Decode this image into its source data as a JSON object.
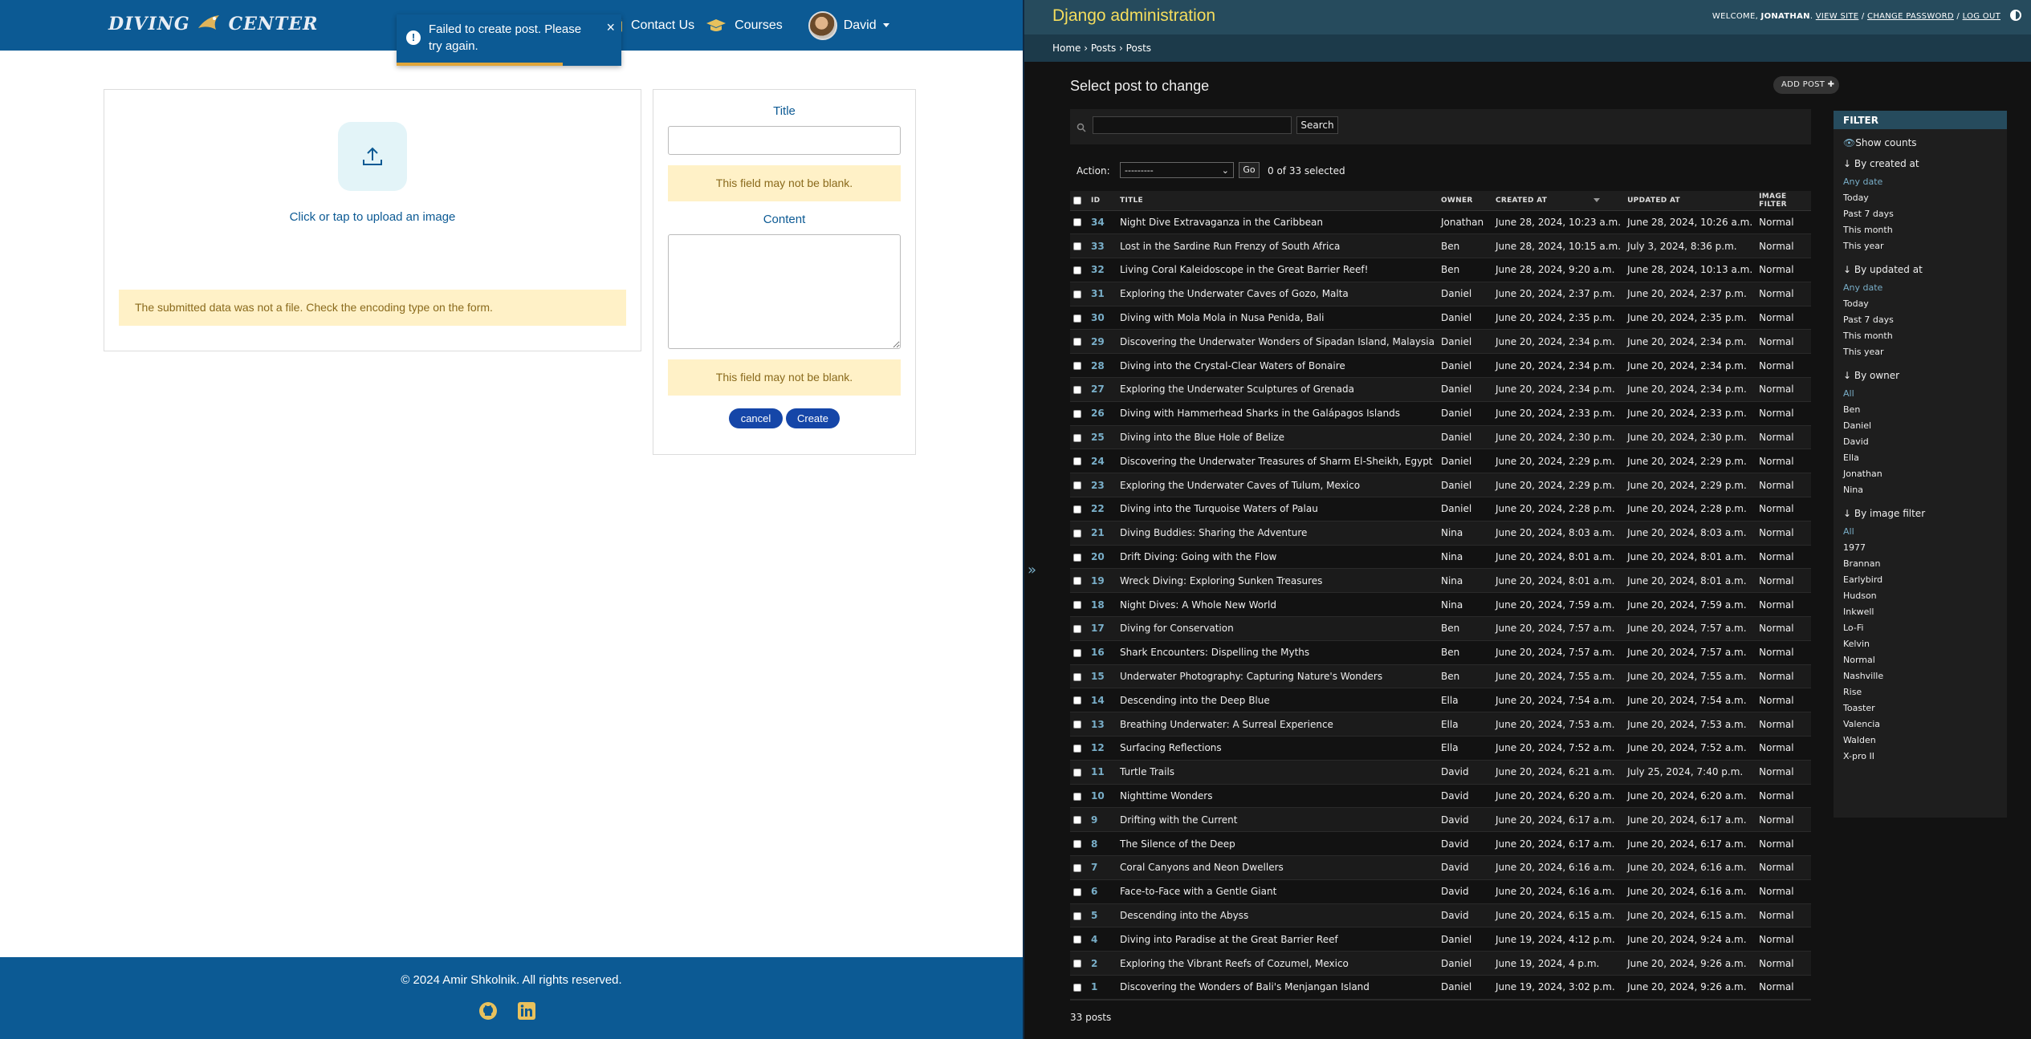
{
  "app": {
    "brand": "DIVING CENTER",
    "nav": {
      "contact": "Contact Us",
      "courses": "Courses",
      "user": "David"
    },
    "toast": {
      "message": "Failed to create post. Please try again.",
      "close": "×"
    },
    "upload": {
      "label": "Click or tap to upload an image",
      "error": "The submitted data was not a file. Check the encoding type on the form."
    },
    "form": {
      "title_label": "Title",
      "title_error": "This field may not be blank.",
      "content_label": "Content",
      "content_error": "This field may not be blank.",
      "cancel": "cancel",
      "create": "Create"
    },
    "footer": {
      "copyright": "© 2024 Amir Shkolnik. All rights reserved."
    }
  },
  "admin": {
    "brand": "Django administration",
    "welcome": "WELCOME,",
    "username": "JONATHAN",
    "view_site": "VIEW SITE",
    "change_password": "CHANGE PASSWORD",
    "logout": "LOG OUT",
    "breadcrumbs": {
      "home": "Home",
      "app": "Posts",
      "model": "Posts"
    },
    "sidebar_toggle": "»",
    "title": "Select post to change",
    "add_button": "ADD POST",
    "search_button": "Search",
    "action_label": "Action:",
    "action_selected": "---------",
    "go": "Go",
    "selected_count": "0 of 33 selected",
    "columns": [
      "ID",
      "TITLE",
      "OWNER",
      "CREATED AT",
      "UPDATED AT",
      "IMAGE FILTER"
    ],
    "rows": [
      [
        "34",
        "Night Dive Extravaganza in the Caribbean",
        "Jonathan",
        "June 28, 2024, 10:23 a.m.",
        "June 28, 2024, 10:26 a.m.",
        "Normal"
      ],
      [
        "33",
        "Lost in the Sardine Run Frenzy of South Africa",
        "Ben",
        "June 28, 2024, 10:15 a.m.",
        "July 3, 2024, 8:36 p.m.",
        "Normal"
      ],
      [
        "32",
        "Living Coral Kaleidoscope in the Great Barrier Reef!",
        "Ben",
        "June 28, 2024, 9:20 a.m.",
        "June 28, 2024, 10:13 a.m.",
        "Normal"
      ],
      [
        "31",
        "Exploring the Underwater Caves of Gozo, Malta",
        "Daniel",
        "June 20, 2024, 2:37 p.m.",
        "June 20, 2024, 2:37 p.m.",
        "Normal"
      ],
      [
        "30",
        "Diving with Mola Mola in Nusa Penida, Bali",
        "Daniel",
        "June 20, 2024, 2:35 p.m.",
        "June 20, 2024, 2:35 p.m.",
        "Normal"
      ],
      [
        "29",
        "Discovering the Underwater Wonders of Sipadan Island, Malaysia",
        "Daniel",
        "June 20, 2024, 2:34 p.m.",
        "June 20, 2024, 2:34 p.m.",
        "Normal"
      ],
      [
        "28",
        "Diving into the Crystal-Clear Waters of Bonaire",
        "Daniel",
        "June 20, 2024, 2:34 p.m.",
        "June 20, 2024, 2:34 p.m.",
        "Normal"
      ],
      [
        "27",
        "Exploring the Underwater Sculptures of Grenada",
        "Daniel",
        "June 20, 2024, 2:34 p.m.",
        "June 20, 2024, 2:34 p.m.",
        "Normal"
      ],
      [
        "26",
        "Diving with Hammerhead Sharks in the Galápagos Islands",
        "Daniel",
        "June 20, 2024, 2:33 p.m.",
        "June 20, 2024, 2:33 p.m.",
        "Normal"
      ],
      [
        "25",
        "Diving into the Blue Hole of Belize",
        "Daniel",
        "June 20, 2024, 2:30 p.m.",
        "June 20, 2024, 2:30 p.m.",
        "Normal"
      ],
      [
        "24",
        "Discovering the Underwater Treasures of Sharm El-Sheikh, Egypt",
        "Daniel",
        "June 20, 2024, 2:29 p.m.",
        "June 20, 2024, 2:29 p.m.",
        "Normal"
      ],
      [
        "23",
        "Exploring the Underwater Caves of Tulum, Mexico",
        "Daniel",
        "June 20, 2024, 2:29 p.m.",
        "June 20, 2024, 2:29 p.m.",
        "Normal"
      ],
      [
        "22",
        "Diving into the Turquoise Waters of Palau",
        "Daniel",
        "June 20, 2024, 2:28 p.m.",
        "June 20, 2024, 2:28 p.m.",
        "Normal"
      ],
      [
        "21",
        "Diving Buddies: Sharing the Adventure",
        "Nina",
        "June 20, 2024, 8:03 a.m.",
        "June 20, 2024, 8:03 a.m.",
        "Normal"
      ],
      [
        "20",
        "Drift Diving: Going with the Flow",
        "Nina",
        "June 20, 2024, 8:01 a.m.",
        "June 20, 2024, 8:01 a.m.",
        "Normal"
      ],
      [
        "19",
        "Wreck Diving: Exploring Sunken Treasures",
        "Nina",
        "June 20, 2024, 8:01 a.m.",
        "June 20, 2024, 8:01 a.m.",
        "Normal"
      ],
      [
        "18",
        "Night Dives: A Whole New World",
        "Nina",
        "June 20, 2024, 7:59 a.m.",
        "June 20, 2024, 7:59 a.m.",
        "Normal"
      ],
      [
        "17",
        "Diving for Conservation",
        "Ben",
        "June 20, 2024, 7:57 a.m.",
        "June 20, 2024, 7:57 a.m.",
        "Normal"
      ],
      [
        "16",
        "Shark Encounters: Dispelling the Myths",
        "Ben",
        "June 20, 2024, 7:57 a.m.",
        "June 20, 2024, 7:57 a.m.",
        "Normal"
      ],
      [
        "15",
        "Underwater Photography: Capturing Nature's Wonders",
        "Ben",
        "June 20, 2024, 7:55 a.m.",
        "June 20, 2024, 7:55 a.m.",
        "Normal"
      ],
      [
        "14",
        "Descending into the Deep Blue",
        "Ella",
        "June 20, 2024, 7:54 a.m.",
        "June 20, 2024, 7:54 a.m.",
        "Normal"
      ],
      [
        "13",
        "Breathing Underwater: A Surreal Experience",
        "Ella",
        "June 20, 2024, 7:53 a.m.",
        "June 20, 2024, 7:53 a.m.",
        "Normal"
      ],
      [
        "12",
        "Surfacing Reflections",
        "Ella",
        "June 20, 2024, 7:52 a.m.",
        "June 20, 2024, 7:52 a.m.",
        "Normal"
      ],
      [
        "11",
        "Turtle Trails",
        "David",
        "June 20, 2024, 6:21 a.m.",
        "July 25, 2024, 7:40 p.m.",
        "Normal"
      ],
      [
        "10",
        "Nighttime Wonders",
        "David",
        "June 20, 2024, 6:20 a.m.",
        "June 20, 2024, 6:20 a.m.",
        "Normal"
      ],
      [
        "9",
        "Drifting with the Current",
        "David",
        "June 20, 2024, 6:17 a.m.",
        "June 20, 2024, 6:17 a.m.",
        "Normal"
      ],
      [
        "8",
        "The Silence of the Deep",
        "David",
        "June 20, 2024, 6:17 a.m.",
        "June 20, 2024, 6:17 a.m.",
        "Normal"
      ],
      [
        "7",
        "Coral Canyons and Neon Dwellers",
        "David",
        "June 20, 2024, 6:16 a.m.",
        "June 20, 2024, 6:16 a.m.",
        "Normal"
      ],
      [
        "6",
        "Face-to-Face with a Gentle Giant",
        "David",
        "June 20, 2024, 6:16 a.m.",
        "June 20, 2024, 6:16 a.m.",
        "Normal"
      ],
      [
        "5",
        "Descending into the Abyss",
        "David",
        "June 20, 2024, 6:15 a.m.",
        "June 20, 2024, 6:15 a.m.",
        "Normal"
      ],
      [
        "4",
        "Diving into Paradise at the Great Barrier Reef",
        "Daniel",
        "June 19, 2024, 4:12 p.m.",
        "June 20, 2024, 9:24 a.m.",
        "Normal"
      ],
      [
        "2",
        "Exploring the Vibrant Reefs of Cozumel, Mexico",
        "Daniel",
        "June 19, 2024, 4 p.m.",
        "June 20, 2024, 9:26 a.m.",
        "Normal"
      ],
      [
        "1",
        "Discovering the Wonders of Bali's Menjangan Island",
        "Daniel",
        "June 19, 2024, 3:02 p.m.",
        "June 20, 2024, 9:26 a.m.",
        "Normal"
      ]
    ],
    "total": "33 posts",
    "filter": {
      "title": "FILTER",
      "show_counts": "Show counts",
      "groups": [
        {
          "title": "↓ By created at",
          "options": [
            "Any date",
            "Today",
            "Past 7 days",
            "This month",
            "This year"
          ],
          "selected": "Any date"
        },
        {
          "title": "↓ By updated at",
          "options": [
            "Any date",
            "Today",
            "Past 7 days",
            "This month",
            "This year"
          ],
          "selected": "Any date"
        },
        {
          "title": "↓ By owner",
          "options": [
            "All",
            "Ben",
            "Daniel",
            "David",
            "Ella",
            "Jonathan",
            "Nina"
          ],
          "selected": "All"
        },
        {
          "title": "↓ By image filter",
          "options": [
            "All",
            "1977",
            "Brannan",
            "Earlybird",
            "Hudson",
            "Inkwell",
            "Lo-Fi",
            "Kelvin",
            "Normal",
            "Nashville",
            "Rise",
            "Toaster",
            "Valencia",
            "Walden",
            "X-pro II"
          ],
          "selected": "All"
        }
      ]
    }
  }
}
